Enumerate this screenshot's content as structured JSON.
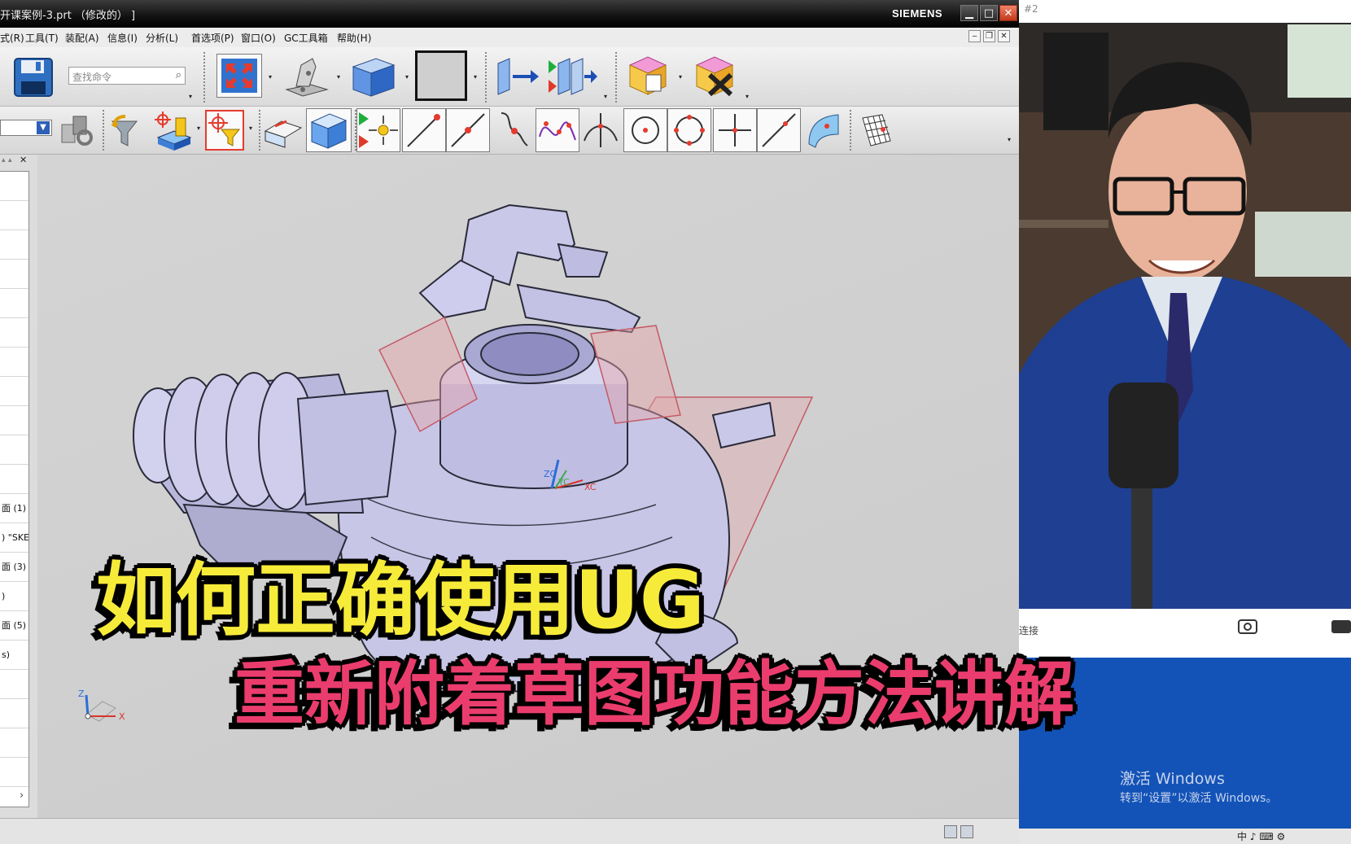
{
  "window": {
    "title": "开课案例-3.prt （修改的） ]",
    "brand": "SIEMENS",
    "minimize": "▁",
    "maximize": "□",
    "close": "✕"
  },
  "menu": {
    "items": [
      "式(R)",
      "工具(T)",
      "装配(A)",
      "信息(I)",
      "分析(L)",
      "首选项(P)",
      "窗口(O)",
      "GC工具箱",
      "帮助(H)"
    ],
    "mdi_buttons": [
      "‒",
      "❐",
      "✕"
    ]
  },
  "toolbar": {
    "search_placeholder": "查找命令"
  },
  "navigator": {
    "rows": [
      "",
      "",
      "",
      "",
      "",
      "",
      "",
      "",
      "",
      "",
      "",
      "面 (1)",
      ") \"SKET",
      "面 (3)",
      ")",
      "面 (5)",
      "s)",
      "",
      "",
      "",
      "",
      "",
      "",
      ""
    ],
    "scroll_right": "›",
    "header_buttons": [
      "▴",
      "▴",
      "✕"
    ]
  },
  "viewport": {
    "csys_labels": {
      "zc": "ZC",
      "yc": "YC",
      "xc": "XC"
    },
    "triad_labels": {
      "z": "Z",
      "x": "X"
    }
  },
  "webcam": {
    "tag": "#2",
    "connect_label": "连接",
    "activate_title": "激活 Windows",
    "activate_sub": "转到“设置”以激活 Windows。",
    "tray": [
      "中",
      "♪",
      "⌨",
      "⚙"
    ]
  },
  "captions": {
    "line1": "如何正确使用UG",
    "line2": "重新附着草图功能方法讲解"
  },
  "colors": {
    "caption1": "#f7eb3a",
    "caption2": "#ea3d6d",
    "model": "#c7c6e6",
    "datum_plane": "#e7a3a9"
  }
}
